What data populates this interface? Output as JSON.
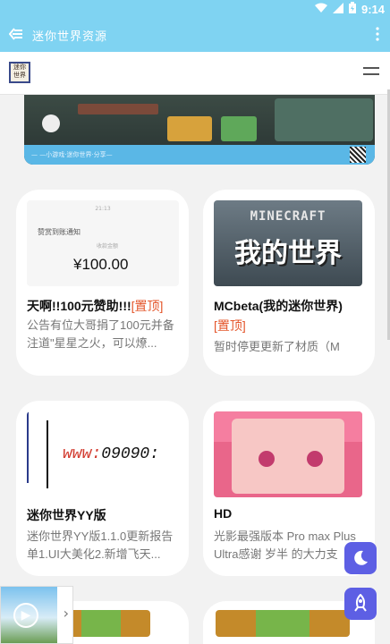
{
  "status_bar": {
    "time": "9:14",
    "icons": [
      "wifi-icon",
      "signal-icon",
      "battery-icon"
    ]
  },
  "app_bar": {
    "title": "迷你世界资源",
    "back_icon": "back-menu-icon",
    "more_icon": "more-vertical-icon"
  },
  "site_header": {
    "logo_text": "迷你世界",
    "menu_icon": "hamburger-icon"
  },
  "banner": {
    "caption": "— —小游戏·迷你世界·分享—",
    "colors": {
      "caption_bg": "#5ab7e6"
    }
  },
  "cards": [
    {
      "title": "天啊!!100元赞助!!!",
      "pin": "[置顶]",
      "desc": "公告有位大哥捐了100元并备注道\"星星之火，可以燎...",
      "thumb": {
        "time": "21:13",
        "notice": "赞赏到账通知",
        "collect": "收款金额",
        "amount": "¥100.00"
      }
    },
    {
      "title": "MCbeta(我的迷你世界)",
      "pin": "[置顶]",
      "desc": "暂时停更更新了材质（M",
      "thumb": {
        "logo": "MINECRAFT",
        "cn": "我的世界"
      }
    },
    {
      "title": "迷你世界YY版",
      "desc": "迷你世界YY版1.1.0更新报告单1.UI大美化2.新增飞天...",
      "thumb": {
        "url_w": "www:",
        "url_n": "09090:"
      }
    },
    {
      "title": "HD",
      "desc": "光影最强版本 Pro max Plus Ultra感谢 岁半 的大力支",
      "thumb": {}
    }
  ],
  "fabs": {
    "dark_mode_icon": "moon-icon",
    "top_icon": "rocket-icon"
  },
  "mini_player": {
    "play_icon": "play-icon",
    "expand_icon": "chevron-right-icon"
  },
  "colors": {
    "accent": "#7fd3f2",
    "fab": "#5d5fe4",
    "pin": "#e4552a"
  }
}
